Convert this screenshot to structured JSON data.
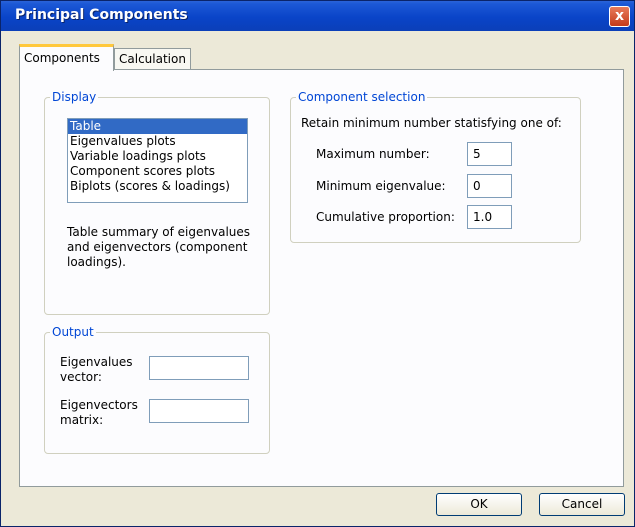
{
  "window": {
    "title": "Principal Components",
    "close_glyph": "x"
  },
  "tabs": [
    {
      "label": "Components",
      "active": true
    },
    {
      "label": "Calculation",
      "active": false
    }
  ],
  "display": {
    "legend": "Display",
    "items": [
      "Table",
      "Eigenvalues plots",
      "Variable loadings plots",
      "Component scores plots",
      "Biplots (scores & loadings)"
    ],
    "selected": "Table",
    "description": "Table summary of eigenvalues and eigenvectors (component loadings)."
  },
  "output": {
    "legend": "Output",
    "eigenvalues_label_1": "Eigenvalues",
    "eigenvalues_label_2": "vector:",
    "eigenvalues_value": "",
    "eigenvectors_label_1": "Eigenvectors",
    "eigenvectors_label_2": "matrix:",
    "eigenvectors_value": ""
  },
  "component_selection": {
    "legend": "Component selection",
    "intro": "Retain minimum number statisfying one of:",
    "max_number_label": "Maximum number:",
    "max_number_value": "5",
    "min_eigenvalue_label": "Minimum eigenvalue:",
    "min_eigenvalue_value": "0",
    "cumulative_label": "Cumulative proportion:",
    "cumulative_value": "1.0"
  },
  "buttons": {
    "ok": "OK",
    "cancel": "Cancel"
  },
  "colors": {
    "title_bar": "#0a44c8",
    "legend": "#0046d5",
    "selection": "#316ac5"
  }
}
